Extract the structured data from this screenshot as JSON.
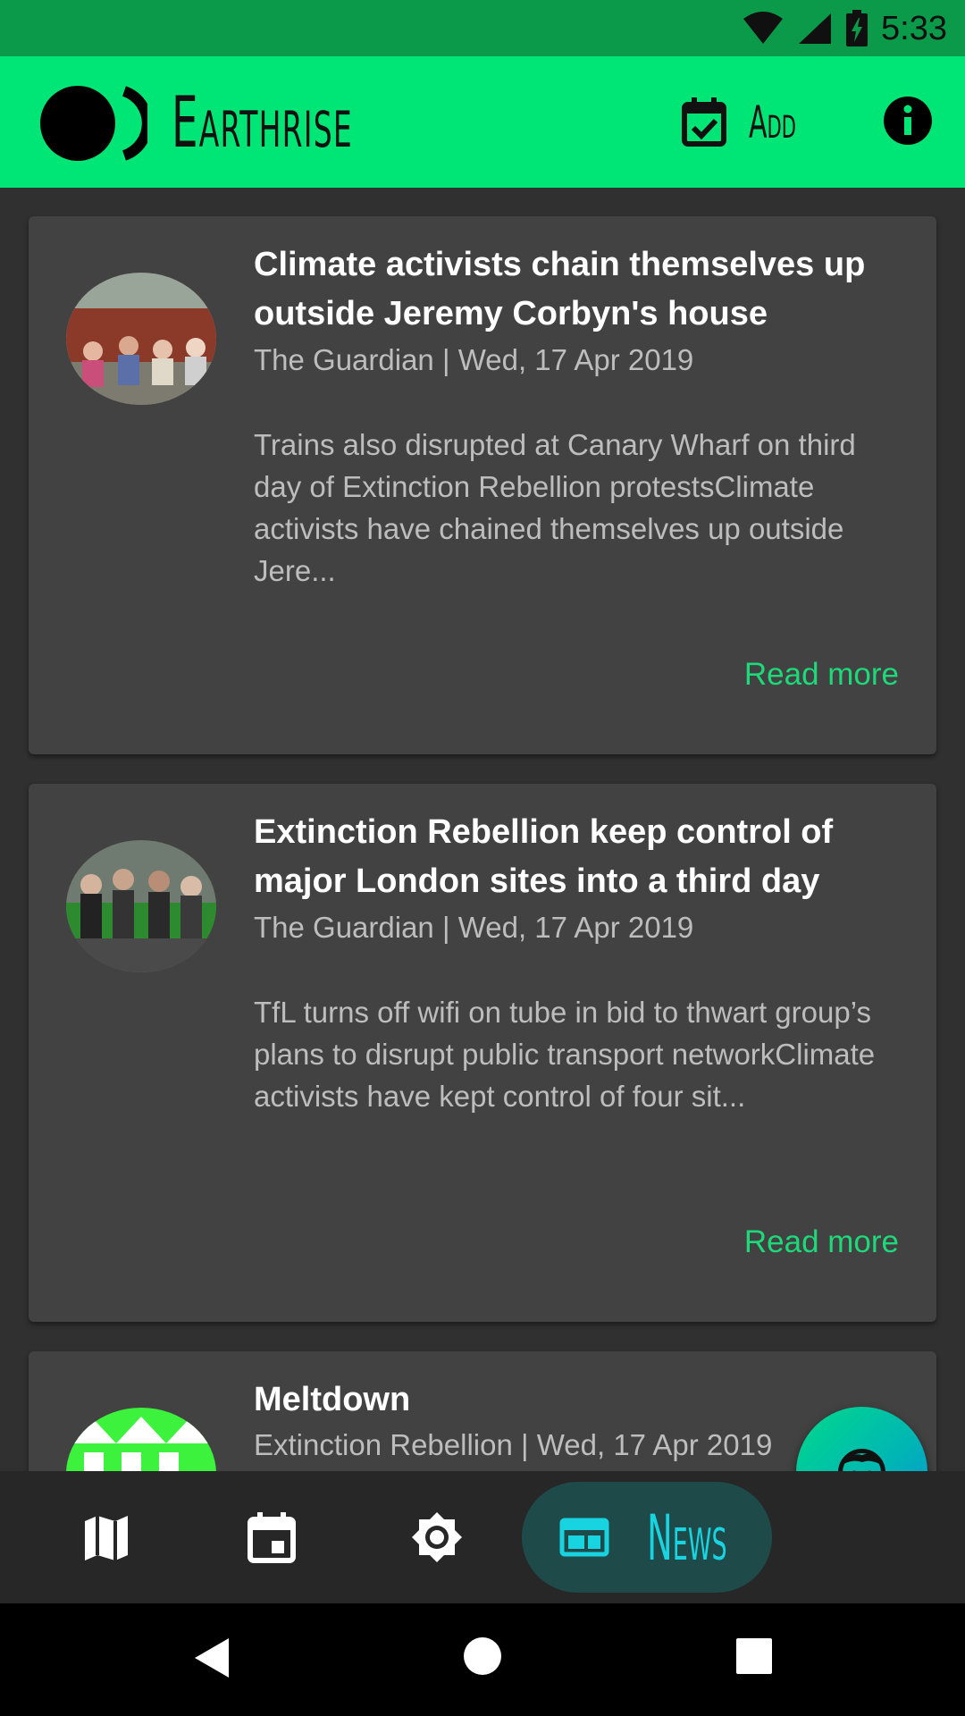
{
  "status_bar": {
    "time": "5:33"
  },
  "app_bar": {
    "title": "Earthrise",
    "add_label": "Add"
  },
  "articles": [
    {
      "title": "Climate activists chain themselves up outside Jeremy Corbyn's house",
      "meta": "The Guardian | Wed, 17 Apr 2019",
      "summary": "Trains also disrupted at Canary Wharf on third day of Extinction Rebellion protestsClimate activists have chained themselves up outside Jere...",
      "read_more": "Read more"
    },
    {
      "title": "Extinction Rebellion keep control of major London sites into a third day",
      "meta": "The Guardian | Wed, 17 Apr 2019",
      "summary": "TfL turns off wifi on tube in bid to thwart group’s plans to disrupt public transport networkClimate activists have kept control of four sit...",
      "read_more": "Read more"
    },
    {
      "title": "Meltdown",
      "meta": "Extinction Rebellion | Wed, 17 Apr 2019"
    }
  ],
  "bottom_nav": {
    "items": [
      "map-icon",
      "calendar-icon",
      "settings-icon",
      "news-icon"
    ],
    "active_label": "News"
  },
  "colors": {
    "app_bar": "#00e676",
    "status_bar": "#0a9a4a",
    "accent": "#1ed97a",
    "card": "#424242",
    "news_highlight": "#18d4e0"
  }
}
